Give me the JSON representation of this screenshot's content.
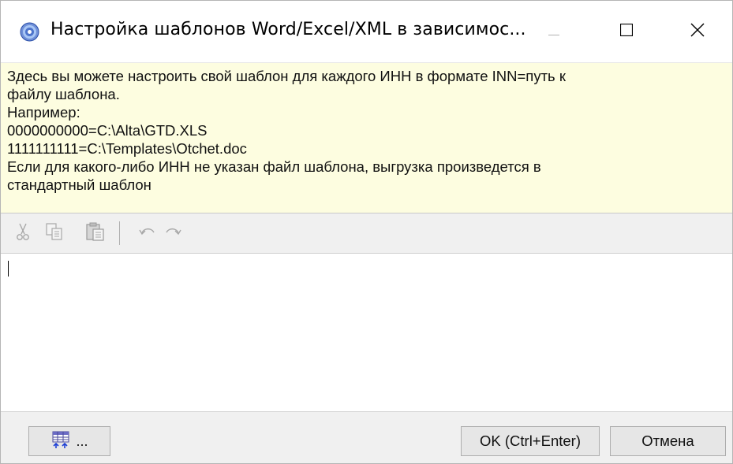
{
  "window": {
    "title": "Настройка шаблонов Word/Excel/XML в зависимос...",
    "app_icon": "blue-disc-icon",
    "controls": {
      "minimize": "minimize-icon",
      "maximize": "maximize-icon",
      "close": "close-icon"
    }
  },
  "info": {
    "lines": [
      "Здесь вы можете настроить свой шаблон для каждого ИНН в формате INN=путь к",
      "файлу шаблона.",
      "Например:",
      "0000000000=C:\\Alta\\GTD.XLS",
      "1111111111=C:\\Templates\\Otchet.doc",
      "Если для какого-либо ИНН не указан файл шаблона, выгрузка произведется в",
      "стандартный шаблон"
    ],
    "background": "#fdfde0"
  },
  "toolbar": {
    "items": [
      "cut-icon",
      "copy-icon",
      "paste-icon",
      "undo-icon",
      "redo-icon"
    ],
    "enabled": false
  },
  "editor": {
    "value": ""
  },
  "buttons": {
    "fields_label": "...",
    "fields_icon": "insert-field-icon",
    "ok_label": "OK (Ctrl+Enter)",
    "cancel_label": "Отмена"
  }
}
